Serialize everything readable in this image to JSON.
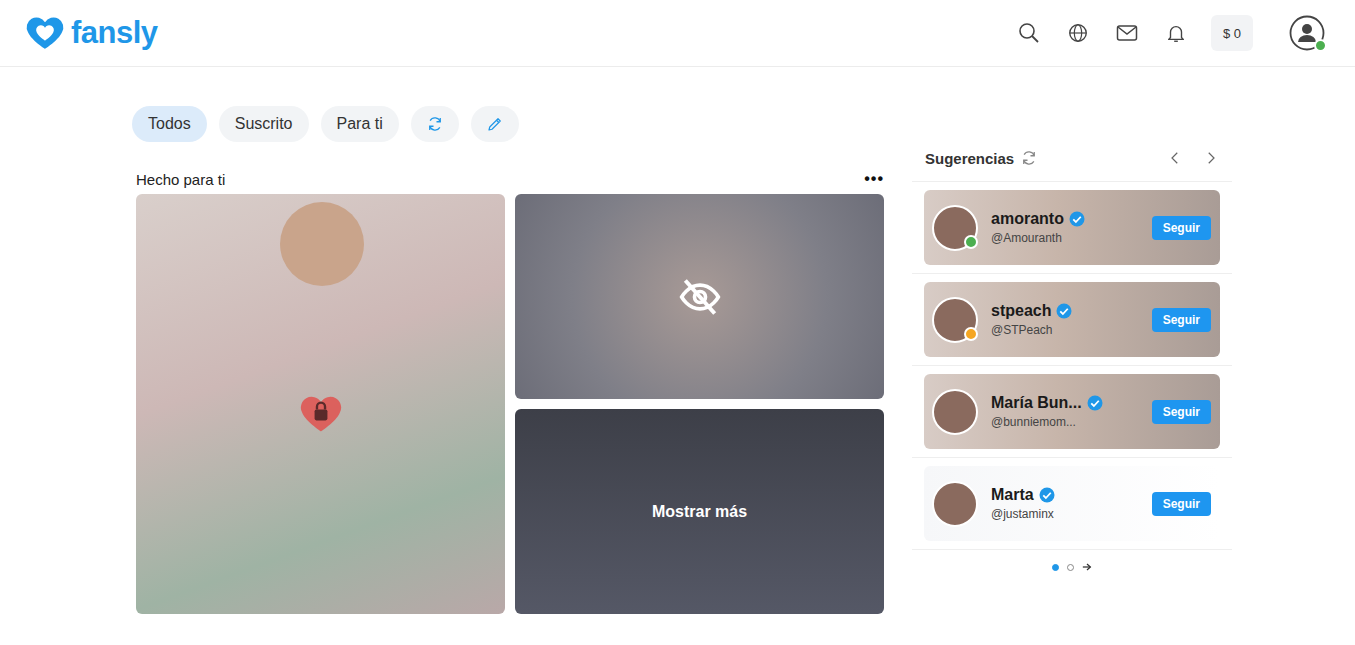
{
  "header": {
    "logo": "fansly",
    "balance": "$ 0",
    "user_online": true
  },
  "tabs": [
    {
      "label": "Todos",
      "selected": true
    },
    {
      "label": "Suscrito",
      "selected": false
    },
    {
      "label": "Para ti",
      "selected": false
    }
  ],
  "feed": {
    "title": "Hecho para ti",
    "menu": "•••",
    "posts": [
      {
        "kind": "locked"
      },
      {
        "kind": "hidden"
      },
      {
        "kind": "more",
        "label": "Mostrar más"
      }
    ]
  },
  "suggestions": {
    "title": "Sugerencias",
    "creators": [
      {
        "name": "amoranto",
        "handle": "@Amouranth",
        "verified": true,
        "status": true,
        "color": "#4caf50",
        "banner": true,
        "button": "Seguir"
      },
      {
        "name": "stpeach",
        "handle": "@STPeach",
        "verified": true,
        "status": true,
        "color": "#f5a623",
        "banner": true,
        "button": "Seguir"
      },
      {
        "name": "María Bun...",
        "handle": "@bunniemom...",
        "verified": true,
        "status": false,
        "color": "#000000",
        "banner": true,
        "button": "Seguir"
      },
      {
        "name": "Marta",
        "handle": "@justaminx",
        "verified": true,
        "status": false,
        "color": "#000000",
        "banner": false,
        "button": "Seguir"
      }
    ],
    "pages": [
      {
        "selected": true
      },
      {
        "selected": false
      }
    ]
  }
}
